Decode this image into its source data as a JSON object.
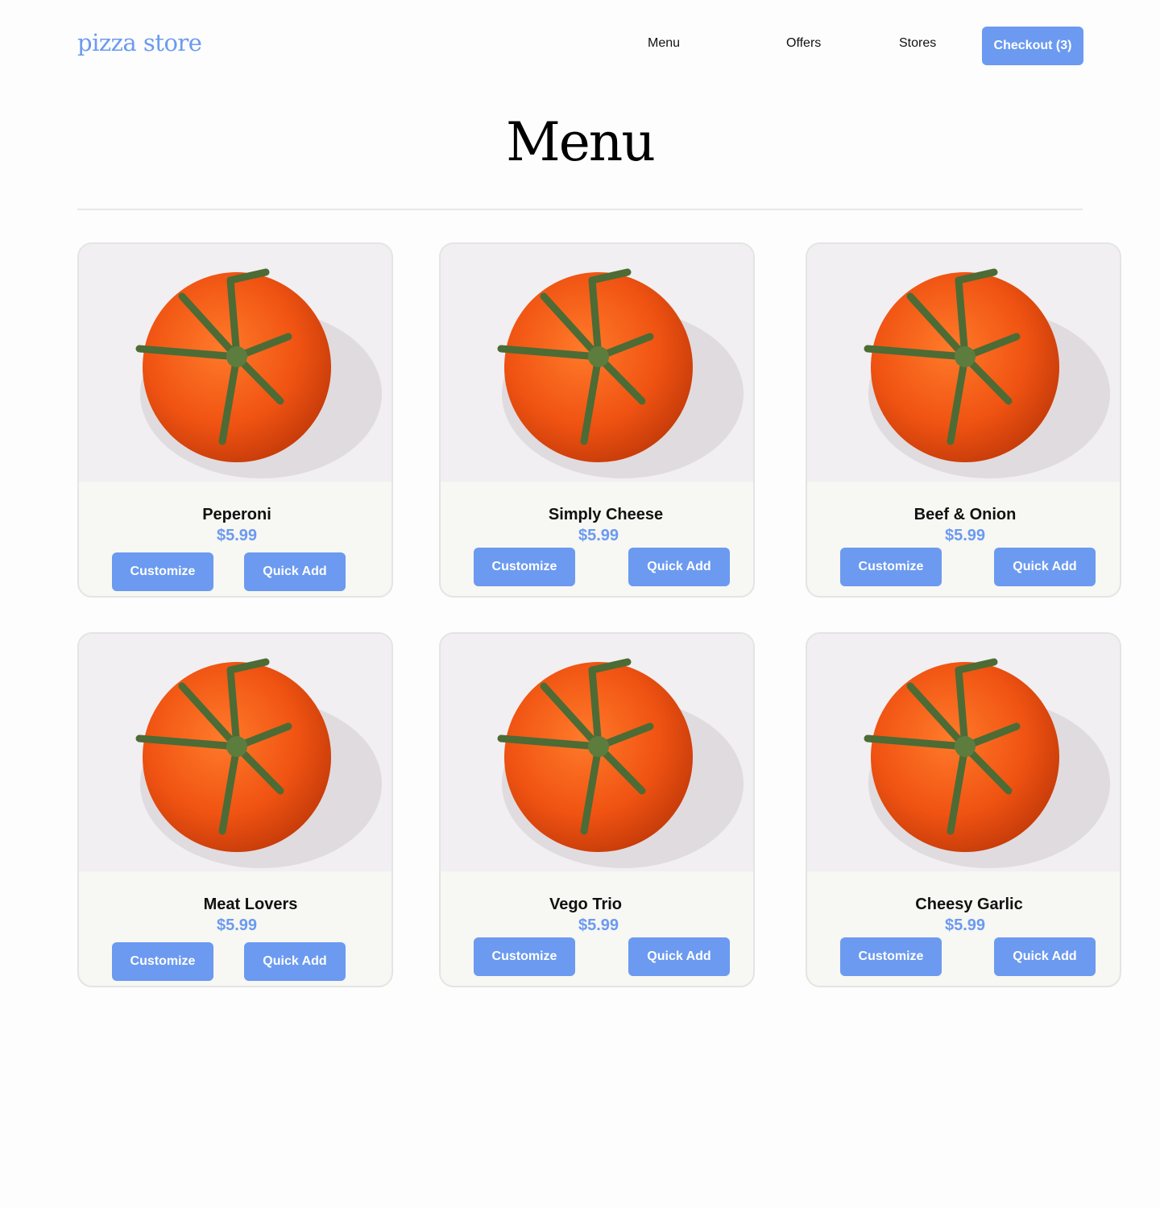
{
  "header": {
    "logo": "pizza store",
    "nav": [
      "Menu",
      "Offers",
      "Stores"
    ],
    "checkout_label": "Checkout (3)"
  },
  "main": {
    "title": "Menu",
    "items": [
      {
        "name": "Peperoni",
        "price": "$5.99",
        "customize_label": "Customize",
        "quick_add_label": "Quick Add",
        "image": "tomato-photo"
      },
      {
        "name": "Simply Cheese",
        "price": "$5.99",
        "customize_label": "Customize",
        "quick_add_label": "Quick Add",
        "image": "tomato-photo"
      },
      {
        "name": "Beef & Onion",
        "price": "$5.99",
        "customize_label": "Customize",
        "quick_add_label": "Quick Add",
        "image": "tomato-photo"
      },
      {
        "name": "Meat Lovers",
        "price": "$5.99",
        "customize_label": "Customize",
        "quick_add_label": "Quick Add",
        "image": "tomato-photo"
      },
      {
        "name": "Vego Trio",
        "price": "$5.99",
        "customize_label": "Customize",
        "quick_add_label": "Quick Add",
        "image": "tomato-photo"
      },
      {
        "name": "Cheesy Garlic",
        "price": "$5.99",
        "customize_label": "Customize",
        "quick_add_label": "Quick Add",
        "image": "tomato-photo"
      }
    ]
  },
  "colors": {
    "accent": "#6b9af0",
    "card_background": "#f7f7f3",
    "image_background": "#f1eff1"
  }
}
